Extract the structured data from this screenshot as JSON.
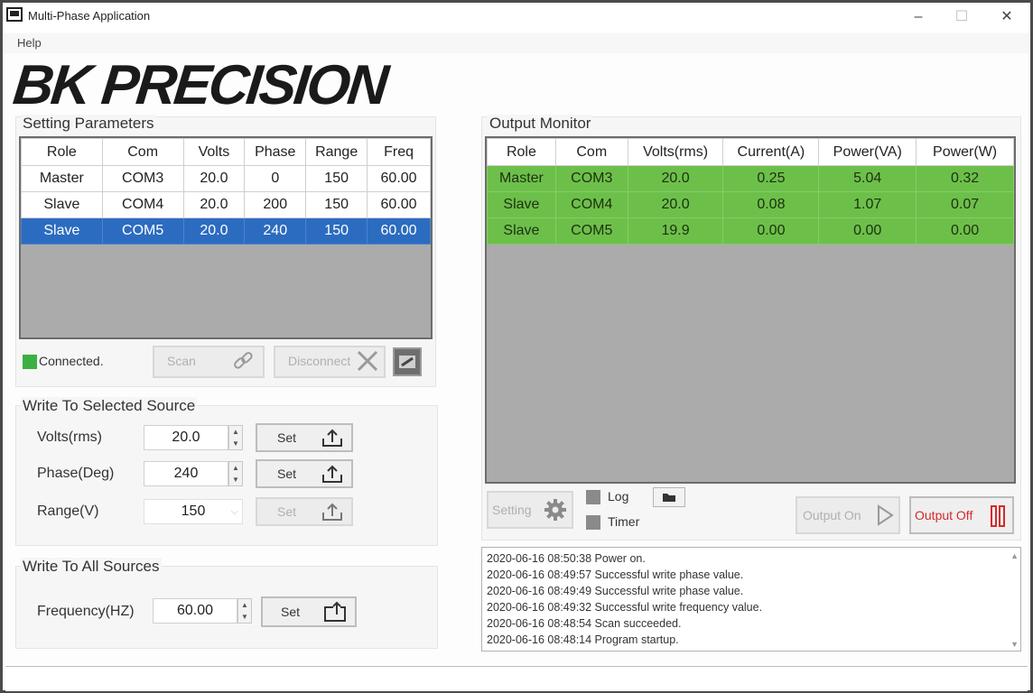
{
  "window": {
    "title": "Multi-Phase Application",
    "controls": [
      "–",
      "☐",
      "✕"
    ]
  },
  "menu": {
    "help": "Help"
  },
  "logo": {
    "text": "BK PRECISION"
  },
  "setting_parameters": {
    "title": "Setting Parameters",
    "columns": [
      "Role",
      "Com",
      "Volts",
      "Phase",
      "Range",
      "Freq"
    ],
    "rows": [
      [
        "Master",
        "COM3",
        "20.0",
        "0",
        "150",
        "60.00"
      ],
      [
        "Slave",
        "COM4",
        "20.0",
        "200",
        "150",
        "60.00"
      ],
      [
        "Slave",
        "COM5",
        "20.0",
        "240",
        "150",
        "60.00"
      ]
    ],
    "selected_row": 2
  },
  "connection": {
    "status": "Connected.",
    "status_color": "#3cb043",
    "scan_label": "Scan",
    "disconnect_label": "Disconnect"
  },
  "write_selected": {
    "title": "Write To Selected Source",
    "volts_label": "Volts(rms)",
    "volts_value": "20.0",
    "phase_label": "Phase(Deg)",
    "phase_value": "240",
    "range_label": "Range(V)",
    "range_value": "150",
    "set_label": "Set"
  },
  "write_all": {
    "title": "Write To All Sources",
    "freq_label": "Frequency(HZ)",
    "freq_value": "60.00",
    "set_label": "Set"
  },
  "output_monitor": {
    "title": "Output Monitor",
    "columns": [
      "Role",
      "Com",
      "Volts(rms)",
      "Current(A)",
      "Power(VA)",
      "Power(W)"
    ],
    "rows": [
      [
        "Master",
        "COM3",
        "20.0",
        "0.25",
        "5.04",
        "0.32"
      ],
      [
        "Slave",
        "COM4",
        "20.0",
        "0.08",
        "1.07",
        "0.07"
      ],
      [
        "Slave",
        "COM5",
        "19.9",
        "0.00",
        "0.00",
        "0.00"
      ]
    ],
    "row_color": "#6cc04a"
  },
  "monitor_controls": {
    "setting_label": "Setting",
    "log_label": "Log",
    "timer_label": "Timer",
    "output_on_label": "Output On",
    "output_off_label": "Output Off",
    "output_off_color": "#d62a2a"
  },
  "log": {
    "lines": [
      "2020-06-16 08:50:38   Power on.",
      "2020-06-16 08:49:57   Successful write phase value.",
      "2020-06-16 08:49:49   Successful write phase value.",
      "2020-06-16 08:49:32   Successful write frequency value.",
      "2020-06-16 08:48:54   Scan succeeded.",
      "2020-06-16 08:48:14   Program startup."
    ]
  }
}
